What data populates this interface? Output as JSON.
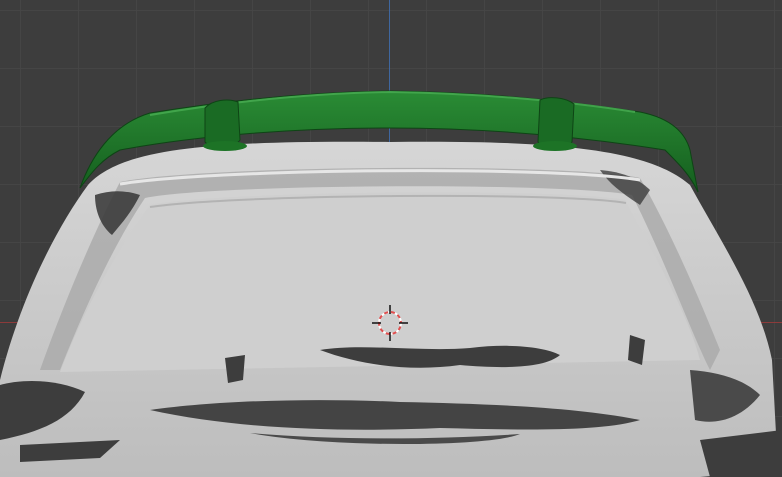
{
  "viewport": {
    "mode": "3d-viewport",
    "background_color": "#3d3d3d",
    "grid_color": "#474747",
    "x_axis_color": "#9a3a3a",
    "y_axis_color": "#3f6fb0"
  },
  "objects": [
    {
      "name": "rear-spoiler",
      "color": "#1f7a2a"
    },
    {
      "name": "scanned-car-rear-mesh",
      "color": "#c8c8c8"
    }
  ],
  "cursor": {
    "icon": "3d-cursor-icon",
    "ring_colors": [
      "#e05050",
      "#ffffff"
    ]
  }
}
